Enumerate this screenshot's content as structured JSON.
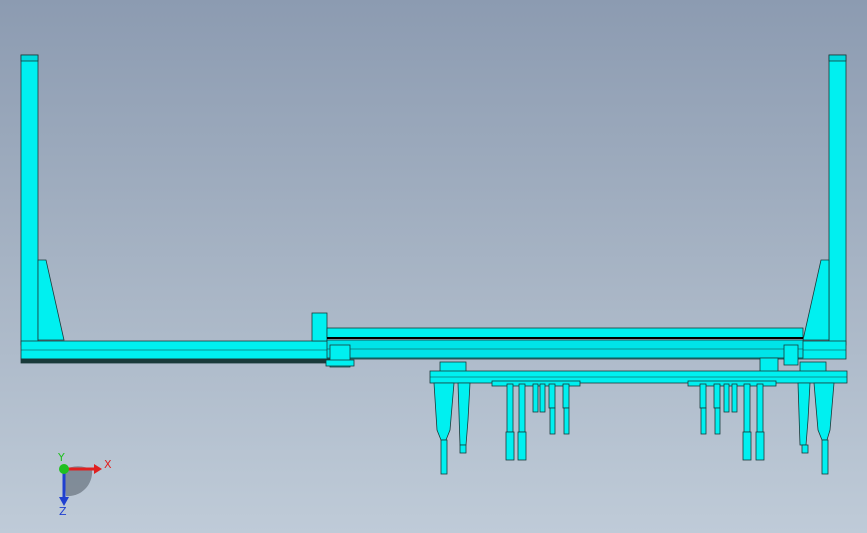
{
  "viewport": {
    "background_top": "#8c9bb1",
    "background_bottom": "#bfcbd8",
    "model_color": "#00f0f0",
    "model_shadow": "#00b4bc",
    "edge_color": "#1a3a3a"
  },
  "triad": {
    "x_label": "X",
    "y_label": "Y",
    "z_label": "Z",
    "x_color": "#e02020",
    "y_color": "#20c020",
    "z_color": "#2040d0"
  }
}
